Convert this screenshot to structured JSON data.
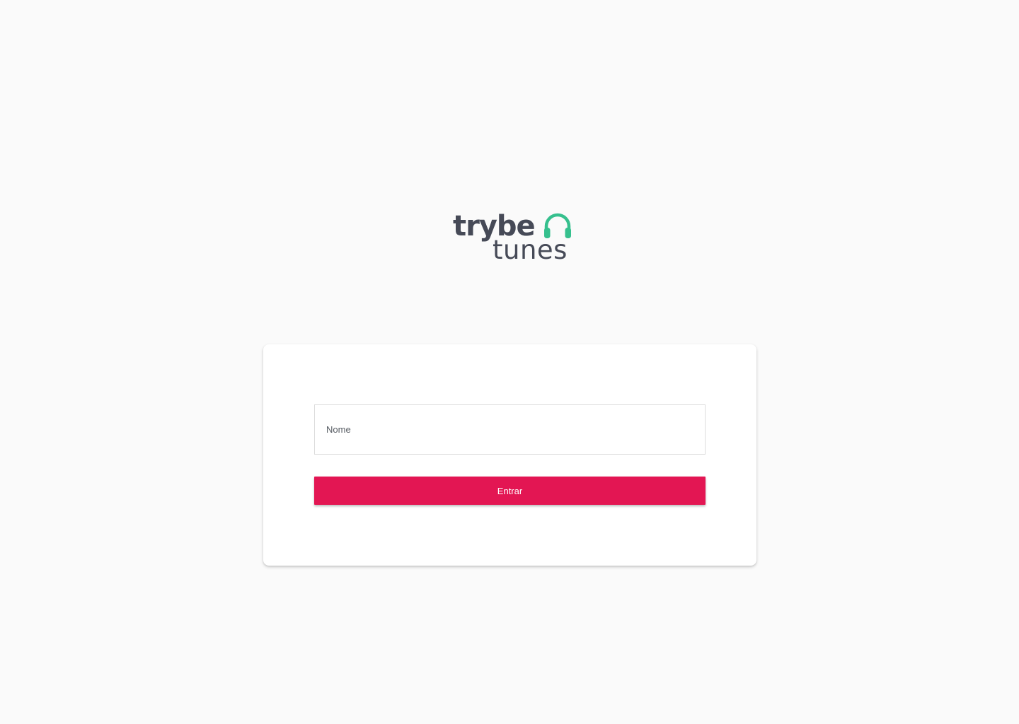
{
  "logo": {
    "word_top": "trybe",
    "word_bottom": "tunes",
    "icon": "headphones-icon",
    "text_color": "#464a57",
    "icon_color": "#36c08e"
  },
  "login": {
    "name_input": {
      "placeholder": "Nome",
      "value": ""
    },
    "submit_label": "Entrar",
    "submit_color": "#e31653"
  },
  "colors": {
    "background": "#fafafa",
    "card": "#ffffff"
  }
}
